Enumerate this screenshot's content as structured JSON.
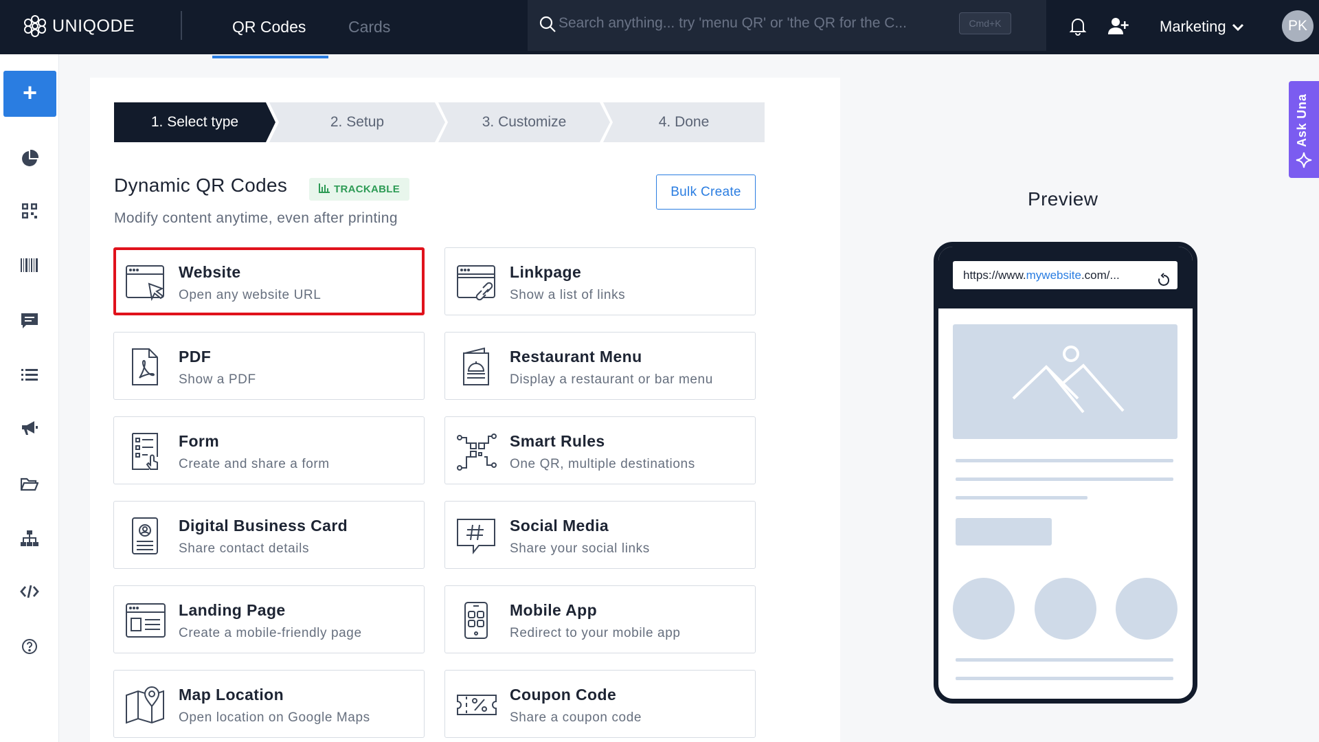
{
  "app": {
    "logo_text": "UNIQODE"
  },
  "topnav": {
    "tabs": [
      {
        "label": "QR Codes",
        "active": true
      },
      {
        "label": "Cards",
        "active": false
      }
    ],
    "search_placeholder": "Search anything... try 'menu QR' or 'the QR for the C...",
    "search_shortcut": "Cmd+K",
    "workspace": "Marketing",
    "avatar_initials": "PK"
  },
  "sidebar": {
    "create_label": "+",
    "items": [
      "analytics-icon",
      "qr-codes-icon",
      "barcode-icon",
      "chat-icon",
      "list-icon",
      "megaphone-icon",
      "folder-icon",
      "hierarchy-icon",
      "code-icon",
      "help-icon"
    ]
  },
  "stepper": {
    "steps": [
      {
        "label": "1. Select type",
        "active": true
      },
      {
        "label": "2. Setup",
        "active": false
      },
      {
        "label": "3. Customize",
        "active": false
      },
      {
        "label": "4. Done",
        "active": false
      }
    ]
  },
  "section": {
    "title": "Dynamic QR Codes",
    "badge": "TRACKABLE",
    "subtitle": "Modify content anytime, even after printing",
    "bulk_create": "Bulk Create"
  },
  "qr_types": [
    {
      "name": "Website",
      "desc": "Open any website URL",
      "icon": "website-icon",
      "selected": true
    },
    {
      "name": "Linkpage",
      "desc": "Show a list of links",
      "icon": "linkpage-icon",
      "selected": false
    },
    {
      "name": "PDF",
      "desc": "Show a PDF",
      "icon": "pdf-icon",
      "selected": false
    },
    {
      "name": "Restaurant Menu",
      "desc": "Display a restaurant or bar menu",
      "icon": "restaurant-menu-icon",
      "selected": false
    },
    {
      "name": "Form",
      "desc": "Create and share a form",
      "icon": "form-icon",
      "selected": false
    },
    {
      "name": "Smart Rules",
      "desc": "One QR, multiple destinations",
      "icon": "smart-rules-icon",
      "selected": false
    },
    {
      "name": "Digital Business Card",
      "desc": "Share contact details",
      "icon": "business-card-icon",
      "selected": false
    },
    {
      "name": "Social Media",
      "desc": "Share your social links",
      "icon": "social-media-icon",
      "selected": false
    },
    {
      "name": "Landing Page",
      "desc": "Create a mobile-friendly page",
      "icon": "landing-page-icon",
      "selected": false
    },
    {
      "name": "Mobile App",
      "desc": "Redirect to your mobile app",
      "icon": "mobile-app-icon",
      "selected": false
    },
    {
      "name": "Map Location",
      "desc": "Open location on Google Maps",
      "icon": "map-location-icon",
      "selected": false
    },
    {
      "name": "Coupon Code",
      "desc": "Share a coupon code",
      "icon": "coupon-code-icon",
      "selected": false
    }
  ],
  "preview": {
    "title": "Preview",
    "url_prefix": "https://www.",
    "url_domain": "mywebsite",
    "url_suffix": ".com/..."
  },
  "assistant": {
    "label": "Ask Una"
  },
  "colors": {
    "topbar": "#121b2b",
    "accent": "#2a7de1",
    "selected_border": "#e0121c",
    "badge_text": "#2d9b55",
    "assistant": "#7b5cf0",
    "placeholder": "#cfdae8"
  }
}
